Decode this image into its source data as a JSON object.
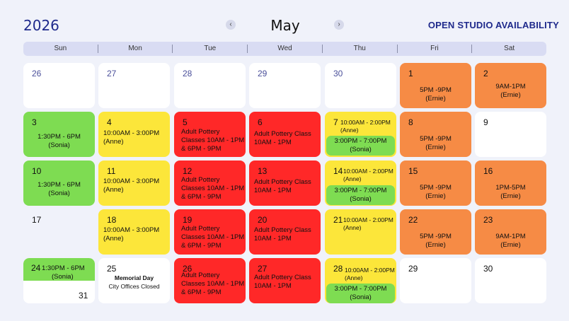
{
  "header": {
    "year": "2026",
    "month": "May",
    "prev_label": "‹",
    "next_label": "›",
    "title": "OPEN STUDIO AVAILABILITY"
  },
  "days_of_week": [
    "Sun",
    "Mon",
    "Tue",
    "Wed",
    "Thu",
    "Fri",
    "Sat"
  ],
  "colors": {
    "orange": "#f68b45",
    "yellow": "#fce63a",
    "red": "#ff2828",
    "green": "#7edc52",
    "accent": "#1f2a8c"
  },
  "weeks": {
    "w1": {
      "sun": {
        "num": "26"
      },
      "mon": {
        "num": "27"
      },
      "tue": {
        "num": "28"
      },
      "wed": {
        "num": "29"
      },
      "thu": {
        "num": "30"
      },
      "fri": {
        "num": "1",
        "l1": "5PM -9PM",
        "l2": "(Ernie)"
      },
      "sat": {
        "num": "2",
        "l1": "9AM-1PM",
        "l2": "(Ernie)"
      }
    },
    "w2": {
      "sun": {
        "num": "3",
        "l1": "1:30PM - 6PM",
        "l2": "(Sonia)"
      },
      "mon": {
        "num": "4",
        "l1": "10:00AM - 3:00PM",
        "l2": "(Anne)"
      },
      "tue": {
        "num": "5",
        "l1": "Adult Pottery",
        "l2": "Classes 10AM - 1PM",
        "l3": "& 6PM - 9PM"
      },
      "wed": {
        "num": "6",
        "l1": "Adult Pottery Class",
        "l2": "10AM - 1PM"
      },
      "thu": {
        "num": "7",
        "l1": "10:00AM - 2:00PM",
        "l2": "(Anne)",
        "s1": "3:00PM - 7:00PM",
        "s2": "(Sonia)"
      },
      "fri": {
        "num": "8",
        "l1": "5PM -9PM",
        "l2": "(Ernie)"
      },
      "sat": {
        "num": "9"
      }
    },
    "w3": {
      "sun": {
        "num": "10",
        "l1": "1:30PM - 6PM",
        "l2": "(Sonia)"
      },
      "mon": {
        "num": "11",
        "l1": "10:00AM - 3:00PM",
        "l2": "(Anne)"
      },
      "tue": {
        "num": "12",
        "l1": "Adult Pottery",
        "l2": "Classes 10AM - 1PM",
        "l3": "& 6PM - 9PM"
      },
      "wed": {
        "num": "13",
        "l1": "Adult Pottery Class",
        "l2": "10AM - 1PM"
      },
      "thu": {
        "num": "14",
        "l1": "10:00AM - 2:00PM",
        "l2": "(Anne)",
        "s1": "3:00PM - 7:00PM",
        "s2": "(Sonia)"
      },
      "fri": {
        "num": "15",
        "l1": "5PM -9PM",
        "l2": "(Ernie)"
      },
      "sat": {
        "num": "16",
        "l1": "1PM-5PM",
        "l2": "(Ernie)"
      }
    },
    "w4": {
      "sun": {
        "num": "17"
      },
      "mon": {
        "num": "18",
        "l1": "10:00AM - 3:00PM",
        "l2": "(Anne)"
      },
      "tue": {
        "num": "19",
        "l1": "Adult Pottery",
        "l2": "Classes 10AM - 1PM",
        "l3": "& 6PM - 9PM"
      },
      "wed": {
        "num": "20",
        "l1": "Adult Pottery Class",
        "l2": "10AM - 1PM"
      },
      "thu": {
        "num": "21",
        "l1": "10:00AM - 2:00PM",
        "l2": "(Anne)"
      },
      "fri": {
        "num": "22",
        "l1": "5PM -9PM",
        "l2": "(Ernie)"
      },
      "sat": {
        "num": "23",
        "l1": "9AM-1PM",
        "l2": "(Ernie)"
      }
    },
    "w5": {
      "sun": {
        "num": "24",
        "l1": "1:30PM - 6PM",
        "l2": "(Sonia)",
        "num2": "31"
      },
      "mon": {
        "num": "25",
        "l1": "Memorial Day",
        "l2": "City Offices Closed"
      },
      "tue": {
        "num": "26",
        "l1": "Adult Pottery",
        "l2": "Classes 10AM - 1PM",
        "l3": "& 6PM - 9PM"
      },
      "wed": {
        "num": "27",
        "l1": "Adult Pottery Class",
        "l2": "10AM - 1PM"
      },
      "thu": {
        "num": "28",
        "l1": "10:00AM - 2:00PM",
        "l2": "(Anne)",
        "s1": "3:00PM - 7:00PM",
        "s2": "(Sonia)"
      },
      "fri": {
        "num": "29"
      },
      "sat": {
        "num": "30"
      }
    }
  }
}
